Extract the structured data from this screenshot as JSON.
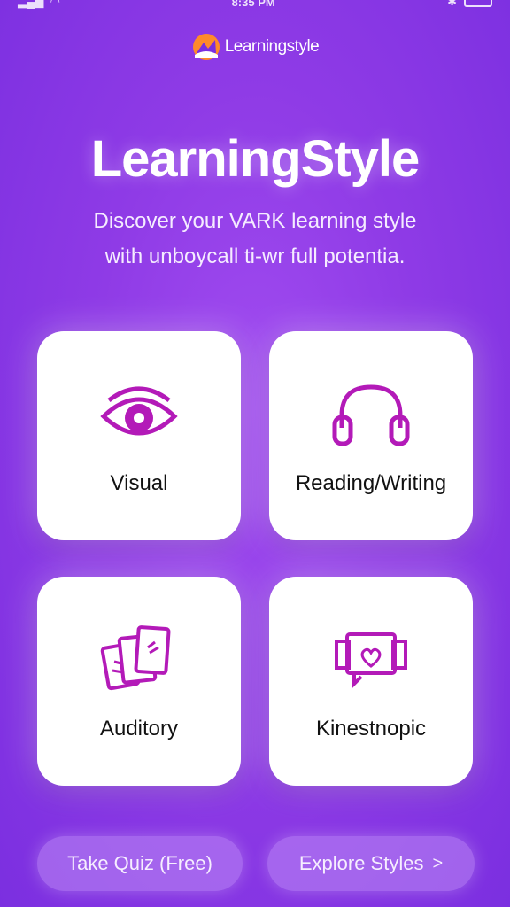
{
  "status_bar": {
    "time": "8:35 PM"
  },
  "brand": {
    "logo_text": "Learningstyle"
  },
  "hero": {
    "title": "LearningStyle",
    "subtitle_line1": "Discover your VARK learning style",
    "subtitle_line2": "with unboycall ti-wr full potentia."
  },
  "cards": {
    "visual": {
      "label": "Visual",
      "icon": "eye-icon"
    },
    "reading": {
      "label": "Reading/Writing",
      "icon": "headphones-icon"
    },
    "auditory": {
      "label": "Auditory",
      "icon": "cards-stack-icon"
    },
    "kinesthetic": {
      "label": "Kinestnopic",
      "icon": "heart-screen-icon"
    }
  },
  "buttons": {
    "quiz": "Take Quiz (Free)",
    "explore": "Explore Styles",
    "explore_chevron": ">"
  },
  "colors": {
    "background": "#8f3be6",
    "accent": "#b31ab8",
    "card": "#ffffff"
  }
}
